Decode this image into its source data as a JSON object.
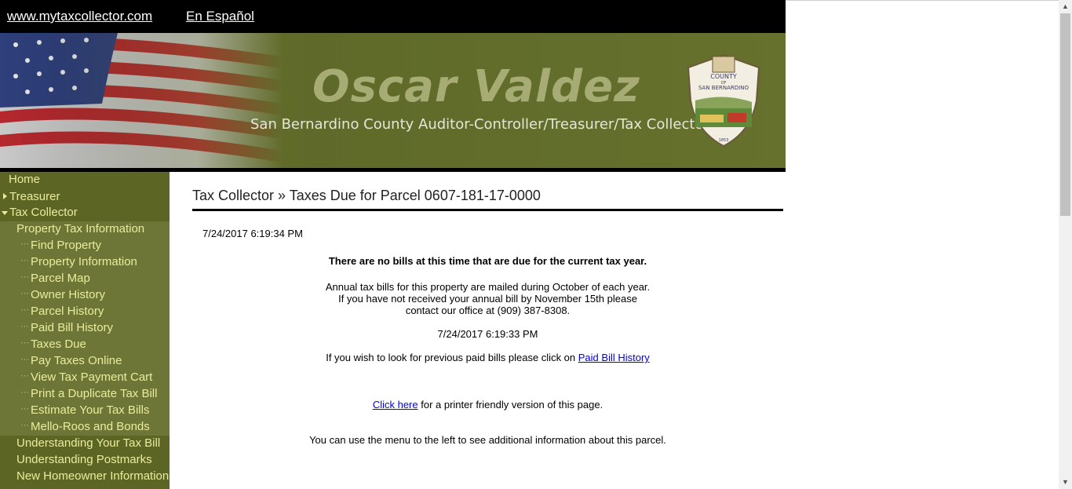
{
  "topbar": {
    "site_link": "www.mytaxcollector.com",
    "spanish_link": "En Español"
  },
  "banner": {
    "name": "Oscar Valdez",
    "subtitle": "San Bernardino County Auditor-Controller/Treasurer/Tax Collector",
    "seal_top": "COUNTY",
    "seal_of": "OF",
    "seal_bottom": "SAN BERNARDINO",
    "seal_year": "1853"
  },
  "sidebar": {
    "items": [
      {
        "label": "Home"
      },
      {
        "label": "Treasurer"
      },
      {
        "label": "Tax Collector"
      },
      {
        "label": "Property Tax Information"
      },
      {
        "label": "Find Property"
      },
      {
        "label": "Property Information"
      },
      {
        "label": "Parcel Map"
      },
      {
        "label": "Owner History"
      },
      {
        "label": "Parcel History"
      },
      {
        "label": "Paid Bill History"
      },
      {
        "label": "Taxes Due"
      },
      {
        "label": "Pay Taxes Online"
      },
      {
        "label": "View Tax Payment Cart"
      },
      {
        "label": "Print a Duplicate Tax Bill"
      },
      {
        "label": "Estimate Your Tax Bills"
      },
      {
        "label": "Mello-Roos and Bonds"
      },
      {
        "label": "Understanding Your Tax Bill"
      },
      {
        "label": "Understanding Postmarks"
      },
      {
        "label": "New Homeowner Information"
      }
    ]
  },
  "main": {
    "heading": "Tax Collector » Taxes Due for Parcel 0607-181-17-0000",
    "timestamp_top": "7/24/2017 6:19:34 PM",
    "no_bills": "There are no bills at this time that are due for the current tax year.",
    "annual_line1": "Annual tax bills for this property are mailed during October of each year.",
    "annual_line2": "If you have not received your annual bill by November 15th please",
    "annual_line3": "contact our office at (909) 387-8308.",
    "timestamp_mid": "7/24/2017 6:19:33 PM",
    "paid_prefix": "If you wish to look for previous paid bills please click on",
    "paid_link": "Paid Bill History",
    "click_here": "Click here",
    "printer_suffix": "for a printer friendly version of this page.",
    "menu_note": "You can use the menu to the left to see additional information about this parcel."
  }
}
